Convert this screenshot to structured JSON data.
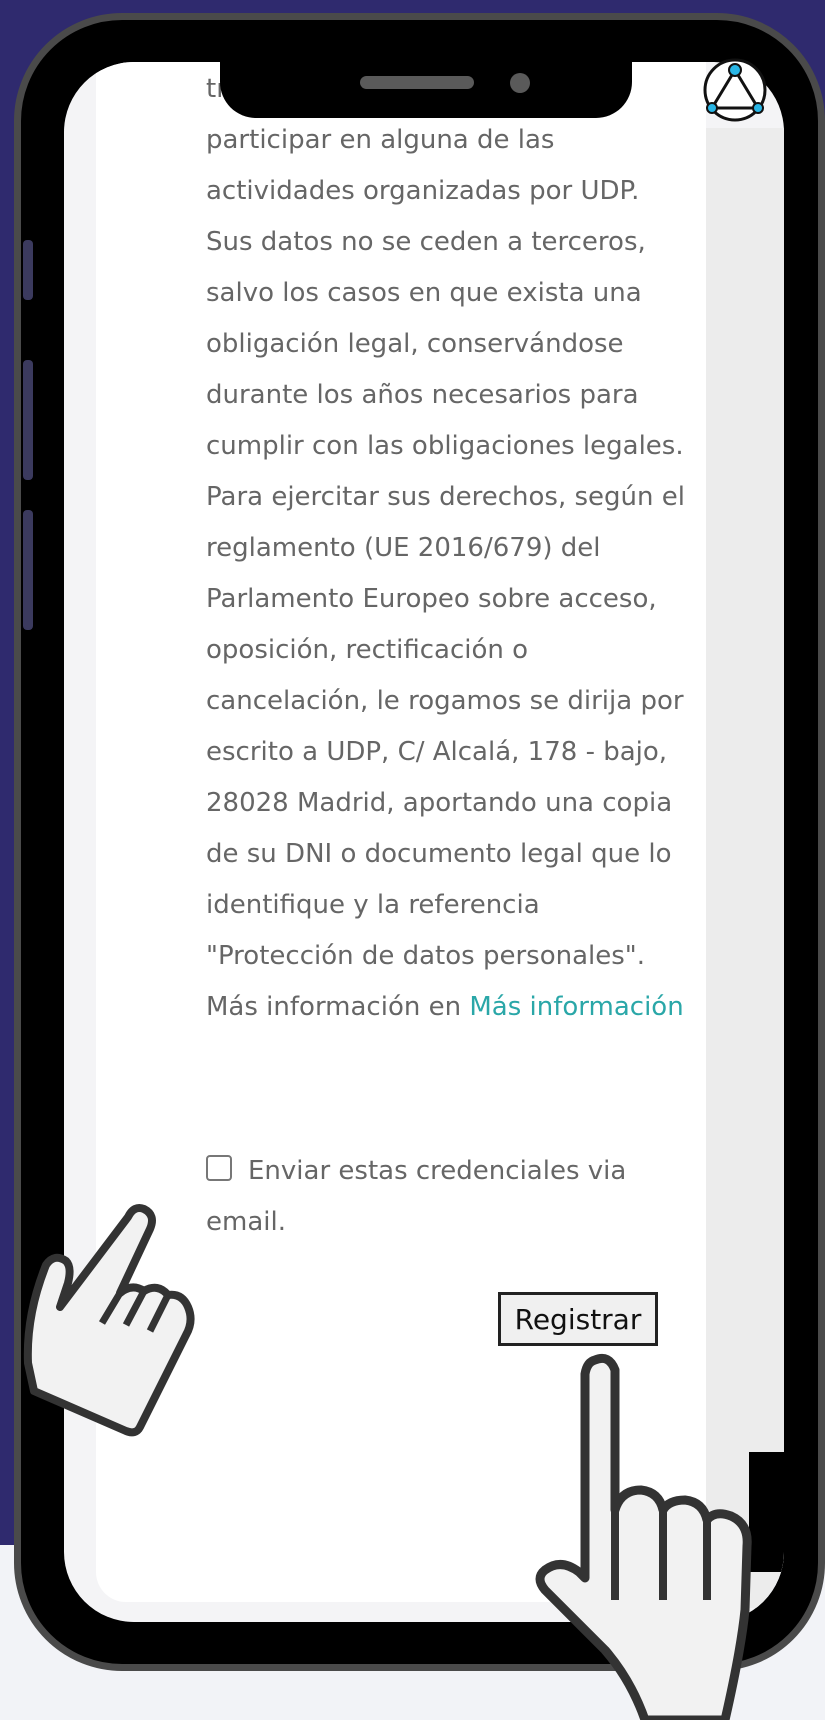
{
  "form": {
    "privacy_text": "tratamiento de sus datos para participar en alguna de las actividades organizadas por UDP. Sus datos no se ceden a terceros, salvo los casos en que exista una obligación legal, conservándose durante los años necesarios para cumplir con las obligaciones legales. Para ejercitar sus derechos, según el reglamento (UE 2016/679) del Parlamento Europeo sobre acceso, oposición, rectificación o cancelación, le rogamos se dirija por escrito a UDP, C/ Alcalá, 178 - bajo, 28028 Madrid, aportando una copia de su DNI o documento legal que lo identifique y la referencia \"Protección de datos personales\".",
    "more_info_prefix": "Más información en",
    "more_info_link": "Más información",
    "send_credentials_label": "Enviar estas credenciales via email.",
    "register_button": "Registrar"
  },
  "colors": {
    "link": "#2aa7a8",
    "background_band": "#2f2a6e",
    "body_text": "#666666"
  },
  "icons": [
    "udp-logo-icon",
    "pointing-hand-icon"
  ]
}
